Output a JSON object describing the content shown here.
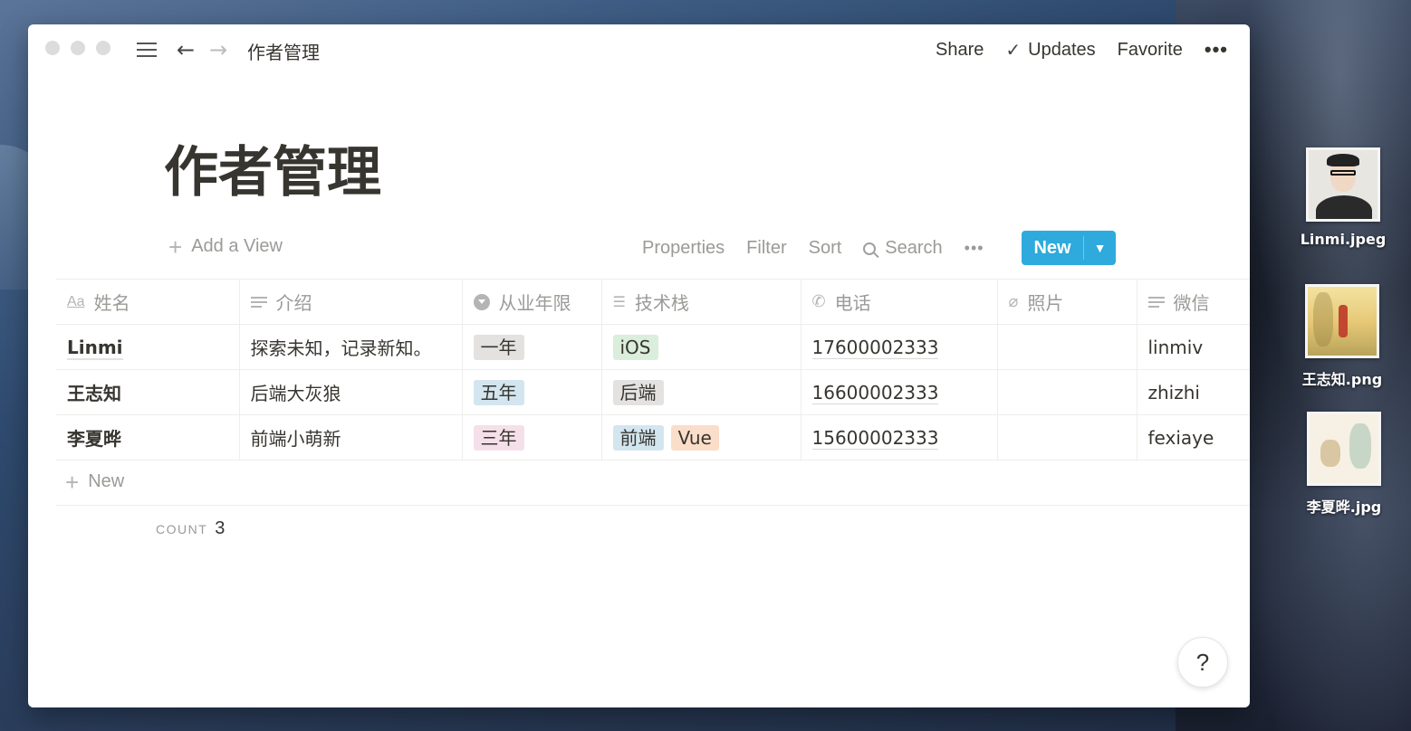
{
  "window": {
    "breadcrumb": "作者管理",
    "actions": {
      "share": "Share",
      "updates": "Updates",
      "favorite": "Favorite",
      "more": "•••"
    }
  },
  "page": {
    "title": "作者管理"
  },
  "viewbar": {
    "add_view": "Add a View",
    "properties": "Properties",
    "filter": "Filter",
    "sort": "Sort",
    "search": "Search",
    "more": "•••",
    "new": "New"
  },
  "table": {
    "columns": [
      {
        "label": "姓名",
        "icon": "title-aa-icon"
      },
      {
        "label": "介绍",
        "icon": "text-lines-icon"
      },
      {
        "label": "从业年限",
        "icon": "select-icon"
      },
      {
        "label": "技术栈",
        "icon": "multi-select-list-icon"
      },
      {
        "label": "电话",
        "icon": "phone-icon"
      },
      {
        "label": "照片",
        "icon": "paperclip-icon"
      },
      {
        "label": "微信",
        "icon": "text-lines-icon"
      }
    ],
    "rows": [
      {
        "name": "Linmi",
        "intro": "探索未知，记录新知。",
        "years": "一年",
        "stack": [
          "iOS"
        ],
        "phone": "17600002333",
        "photo": "",
        "wechat": "linmiv"
      },
      {
        "name": "王志知",
        "intro": "后端大灰狼",
        "years": "五年",
        "stack": [
          "后端"
        ],
        "phone": "16600002333",
        "photo": "",
        "wechat": "zhizhi"
      },
      {
        "name": "李夏晔",
        "intro": "前端小萌新",
        "years": "三年",
        "stack": [
          "前端",
          "Vue"
        ],
        "phone": "15600002333",
        "photo": "",
        "wechat": "fexiaye"
      }
    ],
    "new_row": "New",
    "count_label": "COUNT",
    "count_value": "3"
  },
  "tag_colors": {
    "一年": "#e3e2e0",
    "五年": "#d3e5ef",
    "三年": "#f5e0e9",
    "iOS": "#dbeddb",
    "后端": "#e3e2e0",
    "前端": "#d3e5ef",
    "Vue": "#fadec9"
  },
  "help": "?",
  "desktop": {
    "files": [
      "Linmi.jpeg",
      "王志知.png",
      "李夏晔.jpg"
    ]
  },
  "colors": {
    "accent": "#2eaadc",
    "text": "#37352f",
    "muted": "#9b9a97"
  }
}
